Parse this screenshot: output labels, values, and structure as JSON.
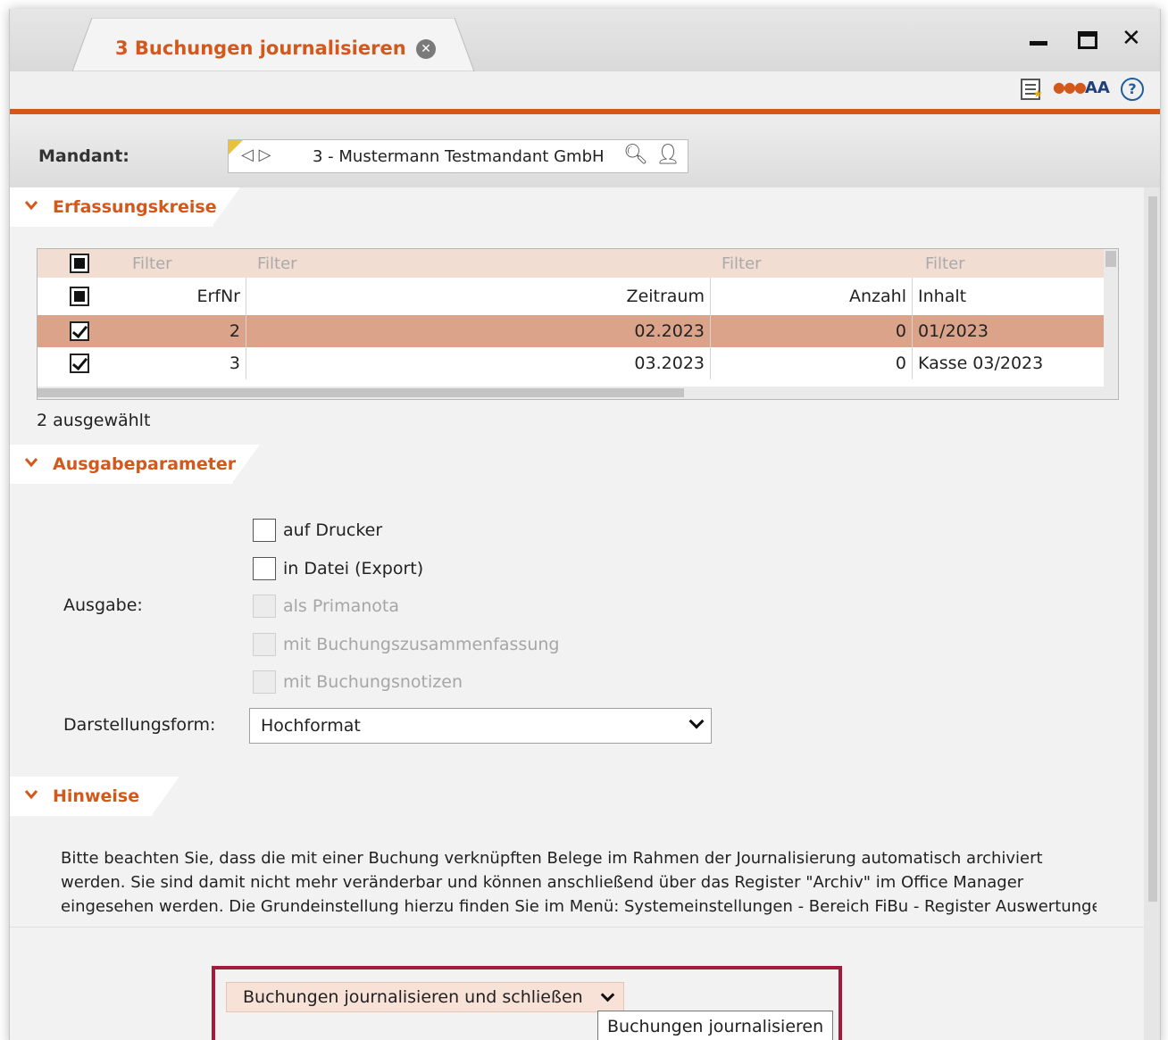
{
  "window": {
    "tab_title": "3 Buchungen journalisieren",
    "controls": {
      "minimize": "minimize-icon",
      "maximize": "maximize-icon",
      "close": "close-icon"
    }
  },
  "toolbar": {
    "icons": [
      "list-star-icon",
      "network-lock-icon",
      "font-size-icon",
      "help-icon"
    ],
    "font_label": "AA",
    "help_label": "?"
  },
  "mandant": {
    "label": "Mandant:",
    "value": "3 - Mustermann Testmandant GmbH",
    "nav": "◁ ▷"
  },
  "erfassungskreise": {
    "title": "Erfassungskreise",
    "filters": [
      "Filter",
      "Filter",
      "Filter",
      "Filter"
    ],
    "columns": [
      "ErfNr",
      "Zeitraum",
      "Anzahl",
      "Inhalt"
    ],
    "rows": [
      {
        "checked": true,
        "erfnr": "2",
        "zeitraum": "02.2023",
        "anzahl": "0",
        "inhalt": "01/2023",
        "selected": true
      },
      {
        "checked": true,
        "erfnr": "3",
        "zeitraum": "03.2023",
        "anzahl": "0",
        "inhalt": "Kasse 03/2023",
        "selected": false
      }
    ],
    "selected_count": "2 ausgewählt"
  },
  "ausgabeparameter": {
    "title": "Ausgabeparameter",
    "ausgabe_label": "Ausgabe:",
    "options": [
      {
        "label": "auf Drucker",
        "enabled": true,
        "checked": false
      },
      {
        "label": "in Datei (Export)",
        "enabled": true,
        "checked": false
      },
      {
        "label": "als Primanota",
        "enabled": false,
        "checked": false
      },
      {
        "label": "mit Buchungszusammenfassung",
        "enabled": false,
        "checked": false
      },
      {
        "label": "mit Buchungsnotizen",
        "enabled": false,
        "checked": false
      }
    ],
    "darstellung_label": "Darstellungsform:",
    "darstellung_value": "Hochformat"
  },
  "hinweise": {
    "title": "Hinweise",
    "lines": [
      "Bitte beachten Sie, dass die mit einer Buchung verknüpften Belege im Rahmen der Journalisierung automatisch  archiviert",
      "werden. Sie sind damit nicht mehr veränderbar und können anschließend über das Register \"Archiv\" im Office Manager",
      "eingesehen werden. Die Grundeinstellung hierzu finden Sie im Menü: Systemeinstellungen - Bereich FiBu - Register Auswertungen"
    ]
  },
  "action": {
    "button_label": "Buchungen journalisieren und schließen",
    "tooltip": "Buchungen journalisieren"
  },
  "colors": {
    "accent": "#d2581c",
    "selected_row": "#dba48a",
    "filter_row": "#f2ddd3",
    "highlight_frame": "#a31a3a"
  }
}
